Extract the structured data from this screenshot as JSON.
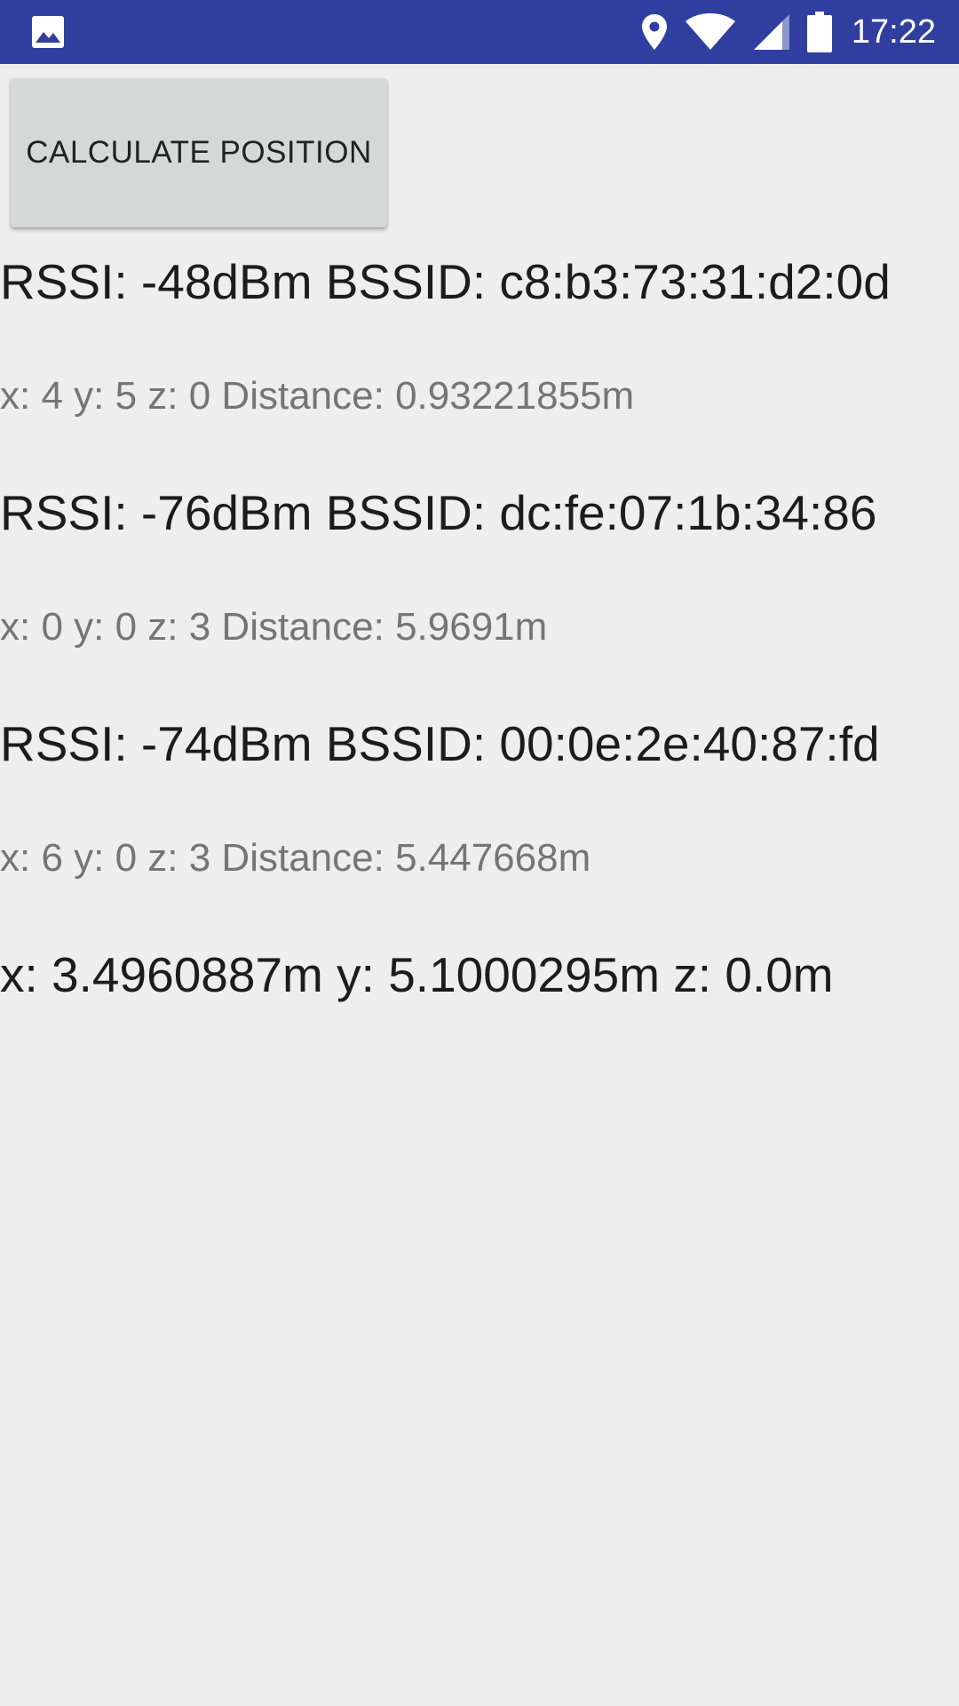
{
  "status_bar": {
    "left_icon": "image-icon",
    "icons": [
      "location-icon",
      "wifi-icon",
      "signal-icon",
      "battery-icon"
    ],
    "time": "17:22",
    "background": "#303f9f"
  },
  "button": {
    "label": "CALCULATE POSITION"
  },
  "access_points": [
    {
      "rssi_line": "RSSI: -48dBm BSSID: c8:b3:73:31:d2:0d",
      "detail_line": "x: 4 y: 5 z: 0 Distance: 0.93221855m"
    },
    {
      "rssi_line": "RSSI: -76dBm BSSID: dc:fe:07:1b:34:86",
      "detail_line": "x: 0 y: 0 z: 3 Distance: 5.9691m"
    },
    {
      "rssi_line": "RSSI: -74dBm BSSID: 00:0e:2e:40:87:fd",
      "detail_line": "x: 6 y: 0 z: 3 Distance: 5.447668m"
    }
  ],
  "result": "x: 3.4960887m y: 5.1000295m z: 0.0m"
}
